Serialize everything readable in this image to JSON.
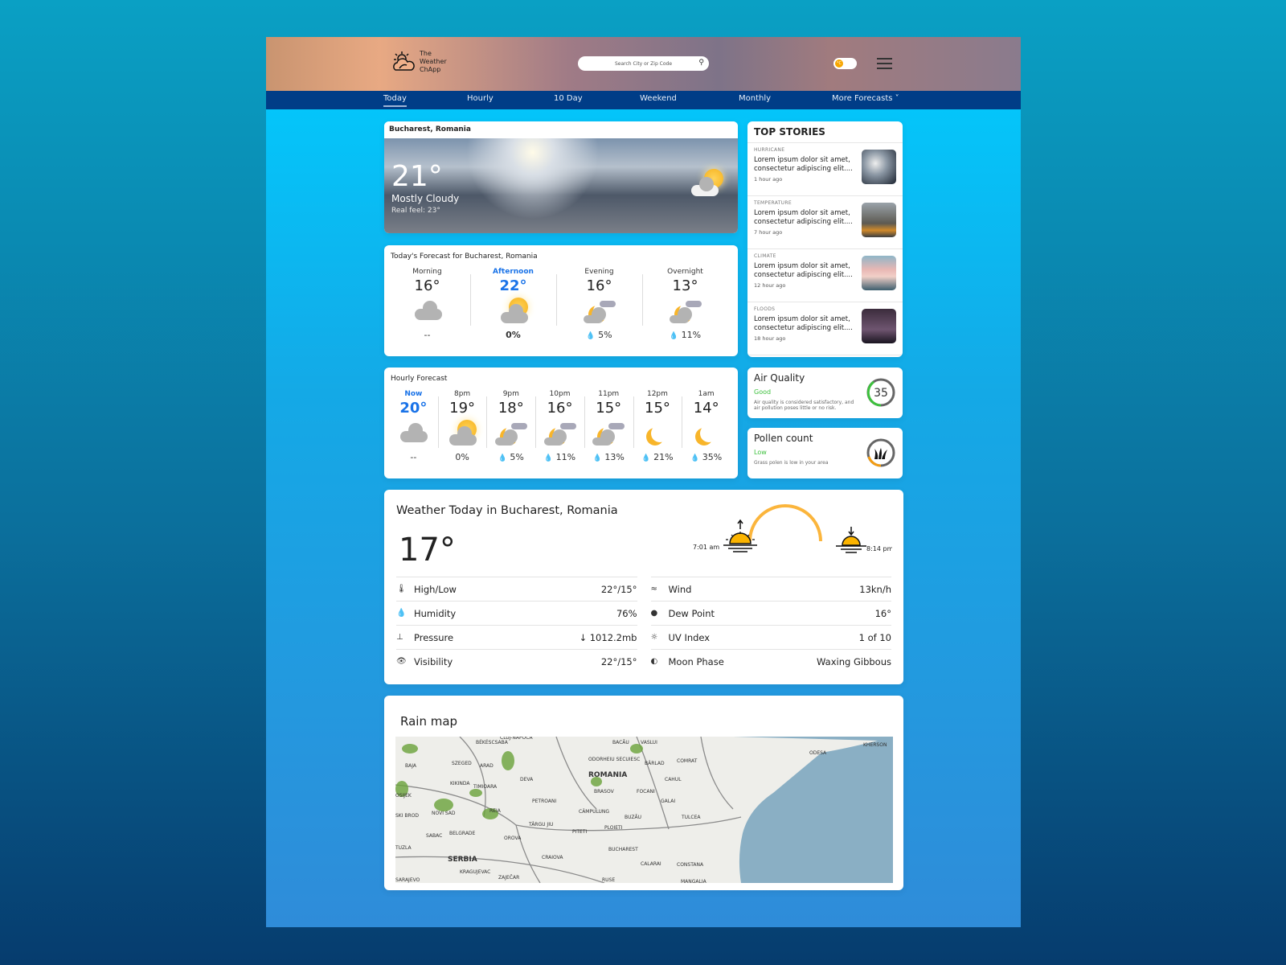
{
  "app": {
    "name": "The Weather ChApp",
    "search_placeholder": "Search City or Zip Code",
    "unit_toggle": "°C"
  },
  "nav": [
    {
      "label": "Today",
      "active": true
    },
    {
      "label": "Hourly"
    },
    {
      "label": "10 Day"
    },
    {
      "label": "Weekend"
    },
    {
      "label": "Monthly"
    },
    {
      "label": "More Forecasts ˅"
    }
  ],
  "current": {
    "location": "Bucharest, Romania",
    "temp": "21°",
    "condition": "Mostly Cloudy",
    "real_feel": "Real feel: 23°"
  },
  "today_forecast": {
    "title": "Today's Forecast for Bucharest, Romania",
    "periods": [
      {
        "label": "Morning",
        "temp": "16°",
        "icon": "cloud-icon",
        "precip": "--"
      },
      {
        "label": "Afternoon",
        "temp": "22°",
        "icon": "partly-sunny-icon",
        "precip": "0%",
        "highlight": true
      },
      {
        "label": "Evening",
        "temp": "16°",
        "icon": "partly-cloudy-night-icon",
        "precip": "5%"
      },
      {
        "label": "Overnight",
        "temp": "13°",
        "icon": "partly-cloudy-night-icon",
        "precip": "11%"
      }
    ]
  },
  "hourly": {
    "title": "Hourly Forecast",
    "hours": [
      {
        "label": "Now",
        "temp": "20°",
        "icon": "cloud-icon",
        "precip": "--"
      },
      {
        "label": "8pm",
        "temp": "19°",
        "icon": "partly-sunny-icon",
        "precip": "0%"
      },
      {
        "label": "9pm",
        "temp": "18°",
        "icon": "partly-cloudy-night-icon",
        "precip": "5%"
      },
      {
        "label": "10pm",
        "temp": "16°",
        "icon": "partly-cloudy-night-icon",
        "precip": "11%"
      },
      {
        "label": "11pm",
        "temp": "15°",
        "icon": "partly-cloudy-night-icon",
        "precip": "13%"
      },
      {
        "label": "12pm",
        "temp": "15°",
        "icon": "moon-icon",
        "precip": "21%"
      },
      {
        "label": "1am",
        "temp": "14°",
        "icon": "moon-icon",
        "precip": "35%"
      }
    ]
  },
  "top_stories": {
    "title": "TOP STORIES",
    "items": [
      {
        "category": "HURRICANE",
        "text": "Lorem ipsum dolor sit amet, consectetur adipiscing elit....",
        "ago": "1 hour ago"
      },
      {
        "category": "TEMPERATURE",
        "text": "Lorem ipsum dolor sit amet, consectetur adipiscing elit....",
        "ago": "7 hour ago"
      },
      {
        "category": "CLIMATE",
        "text": "Lorem ipsum dolor sit amet, consectetur adipiscing elit....",
        "ago": "12 hour ago"
      },
      {
        "category": "FLOODS",
        "text": "Lorem ipsum dolor sit amet, consectetur adipiscing elit....",
        "ago": "18 hour ago"
      }
    ]
  },
  "air_quality": {
    "title": "Air Quality",
    "status": "Good",
    "description": "Air quality is considered satisfactory, and air pollution poses little or no risk.",
    "value": "35",
    "color": "#3ec13e"
  },
  "pollen": {
    "title": "Pollen count",
    "status": "Low",
    "description": "Grass polen is low in your area",
    "color": "#f39c12"
  },
  "weather_today": {
    "title": "Weather Today in Bucharest, Romania",
    "temp": "17°",
    "sunrise": "7:01 am",
    "sunset": "8:14 pm",
    "left": [
      {
        "icon": "thermometer-icon",
        "label": "High/Low",
        "value": "22°/15°"
      },
      {
        "icon": "humidity-icon",
        "label": "Humidity",
        "value": "76%"
      },
      {
        "icon": "pressure-icon",
        "label": "Pressure",
        "value": "↓ 1012.2mb"
      },
      {
        "icon": "visibility-icon",
        "label": "Visibility",
        "value": "22°/15°"
      }
    ],
    "right": [
      {
        "icon": "wind-icon",
        "label": "Wind",
        "value": "13kn/h"
      },
      {
        "icon": "dew-point-icon",
        "label": "Dew Point",
        "value": "16°"
      },
      {
        "icon": "uv-icon",
        "label": "UV Index",
        "value": "1 of 10"
      },
      {
        "icon": "moon-phase-icon",
        "label": "Moon Phase",
        "value": "Waxing Gibbous"
      }
    ]
  },
  "rain_map": {
    "title": "Rain map",
    "labels": [
      "CLUJ-NAPOCA",
      "BÉKÉSCSABA",
      "BACĂU",
      "VASLUI",
      "ODESA",
      "KHERSON",
      "SZEGED",
      "ARAD",
      "BAJA",
      "ODORHEIU SECUIESC",
      "BÂRLAD",
      "COMRAT",
      "ROMANIA",
      "DEVA",
      "KIKINDA",
      "TIMIOARA",
      "CAHUL",
      "OSIJEK",
      "BRASOV",
      "FOCANI",
      "GALAI",
      "PETROANI",
      "NOVI SAD",
      "REIA",
      "CÂMPULUNG",
      "BUZĂU",
      "TULCEA",
      "SKI BROD",
      "TÂRGU JIU",
      "PLOIETI",
      "BELGRADE",
      "OROVA",
      "PITETI",
      "SABAC",
      "TUZLA",
      "BUCHAREST",
      "SERBIA",
      "CRAIOVA",
      "CALARAI",
      "CONSTANA",
      "KRAGUJEVAC",
      "ZAJEČAR",
      "RUSE",
      "MANGALIA",
      "SARAJEVO"
    ]
  }
}
